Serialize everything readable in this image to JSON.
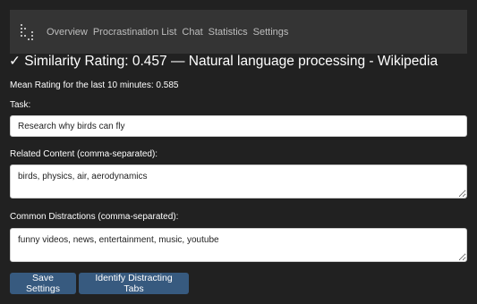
{
  "nav": {
    "items": [
      {
        "label": "Overview"
      },
      {
        "label": "Procrastination List"
      },
      {
        "label": "Chat"
      },
      {
        "label": "Statistics"
      },
      {
        "label": "Settings"
      }
    ]
  },
  "header": {
    "similarity_title": "✓ Similarity Rating: 0.457 — Natural language processing - Wikipedia"
  },
  "stats": {
    "mean_rating": "Mean Rating for the last 10 minutes: 0.585"
  },
  "form": {
    "task_label": "Task:",
    "task_value": "Research why birds can fly",
    "related_label": "Related Content (comma-separated):",
    "related_value": "birds, physics, air, aerodynamics",
    "distractions_label": "Common Distractions (comma-separated):",
    "distractions_value": "funny videos, news, entertainment, music, youtube"
  },
  "buttons": {
    "save": "Save Settings",
    "identify": "Identify Distracting Tabs"
  },
  "colors": {
    "background": "#212121",
    "navbar": "#343434",
    "button": "#375a7f"
  }
}
